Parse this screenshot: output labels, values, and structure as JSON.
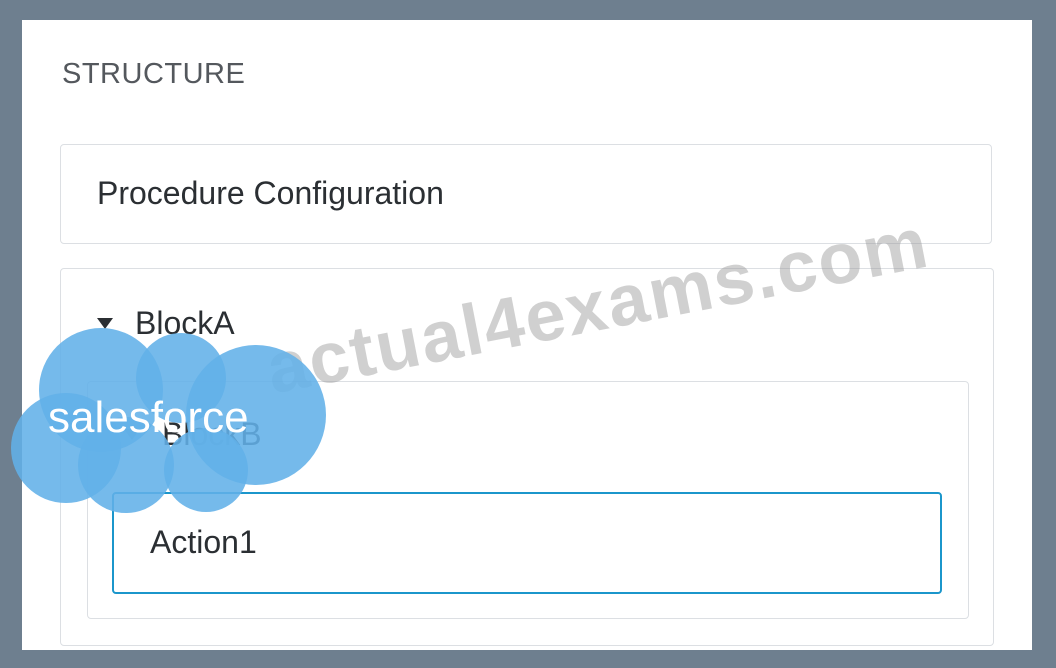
{
  "structure": {
    "heading": "STRUCTURE",
    "procedure_label": "Procedure Configuration",
    "block_a_label": "BlockA",
    "block_b_label": "BlockB",
    "action_label": "Action1"
  },
  "overlays": {
    "watermark_text": "actual4exams.com",
    "logo_text": "salesforce"
  },
  "icons": {
    "expand": "caret-down-icon"
  },
  "colors": {
    "frame_background": "#6e7f8f",
    "selected_border": "#1b96cb",
    "logo_blue": "#62b0e8"
  }
}
